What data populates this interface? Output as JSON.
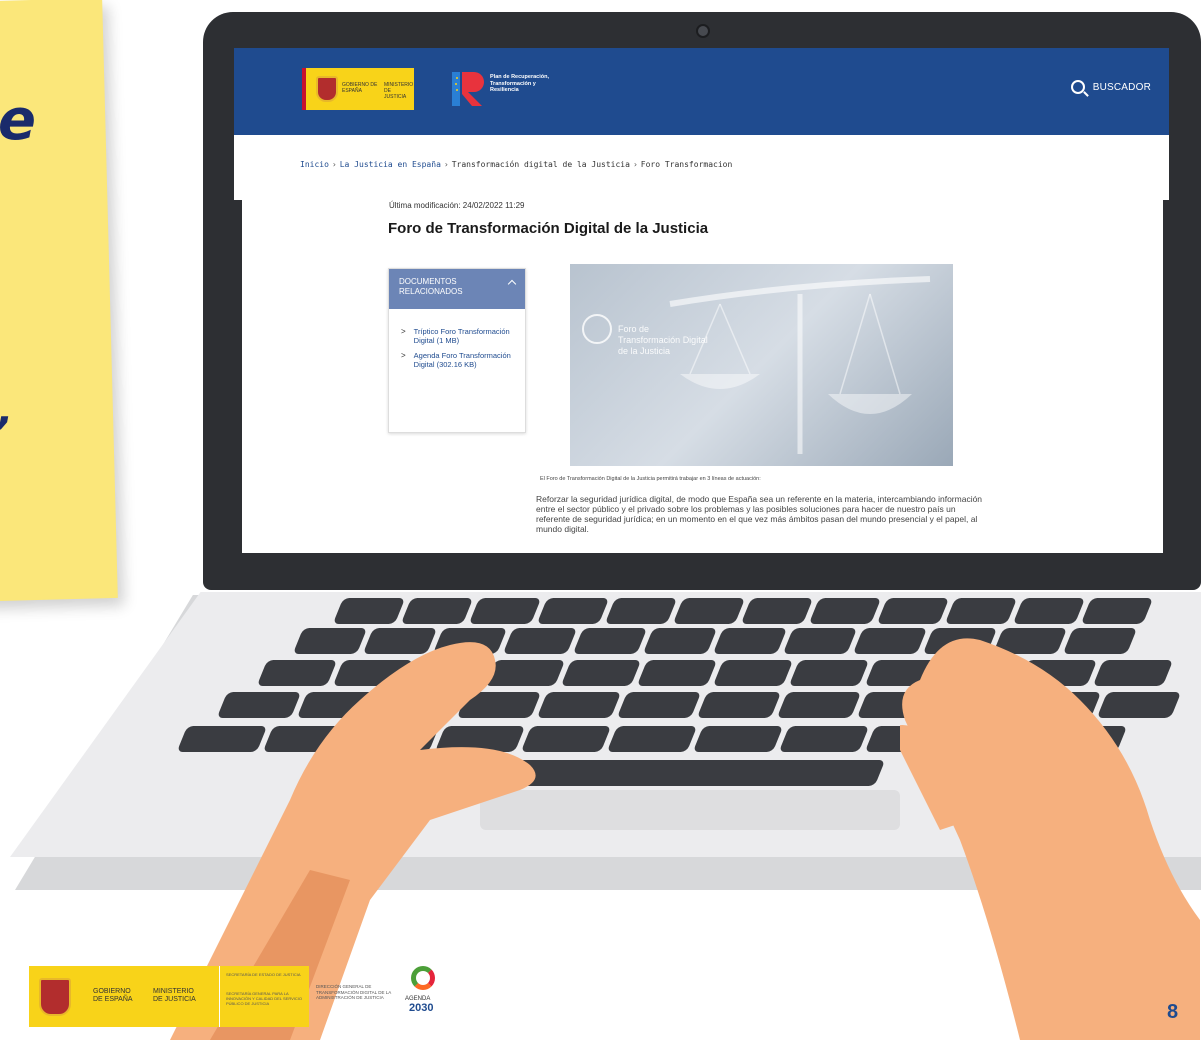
{
  "site": {
    "header": {
      "gov_label": "GOBIERNO DE ESPAÑA",
      "ministry_label": "MINISTERIO DE JUSTICIA",
      "plan_label": "Plan de Recuperación, Transformación y Resiliencia",
      "search_label": "BUSCADOR"
    },
    "breadcrumb": [
      "Inicio",
      "La Justicia en España",
      "Transformación digital de la Justicia",
      "Foro Transformacion"
    ],
    "last_modified": "Última modificación: 24/02/2022 11:29",
    "page_title": "Foro de Transformación Digital de la Justicia",
    "documents_panel": {
      "title": "DOCUMENTOS RELACIONADOS",
      "items": [
        "Tríptico Foro Transformación Digital (1 MB)",
        "Agenda Foro Transformación Digital (302.16 KB)"
      ]
    },
    "hero_caption": "Foro de Transformación Digital de la Justicia",
    "intro_text": "El Foro de Transformación Digital de la Justicia permitirá trabajar en 3 líneas de actuación:",
    "bullet_text": "Reforzar la seguridad jurídica digital, de modo que España sea un referente en la materia, intercambiando información entre el sector público y el privado sobre los problemas y las posibles soluciones para hacer de nuestro país un referente de seguridad jurídica; en un momento en el que vez más ámbitos pasan del mundo presencial y el papel, al mundo digital."
  },
  "footer": {
    "gov_label": "GOBIERNO DE ESPAÑA",
    "ministry_label": "MINISTERIO DE JUSTICIA",
    "secretaria_label": "SECRETARÍA DE ESTADO DE JUSTICIA",
    "secretaria_sub": "SECRETARÍA GENERAL PARA LA INNOVACIÓN Y CALIDAD DEL SERVICIO PÚBLICO DE JUSTICIA",
    "direccion_label": "DIRECCIÓN GENERAL DE TRANSFORMACIÓN DIGITAL DE LA ADMINISTRACIÓN DE JUSTICIA",
    "agenda_label": "AGENDA",
    "agenda_year": "2030",
    "page_number": "8"
  },
  "colors": {
    "header_blue": "#1f4b8f",
    "panel_blue": "#6c85b6",
    "flag_yellow": "#f8d319",
    "sticky_yellow": "#fbe77a"
  }
}
